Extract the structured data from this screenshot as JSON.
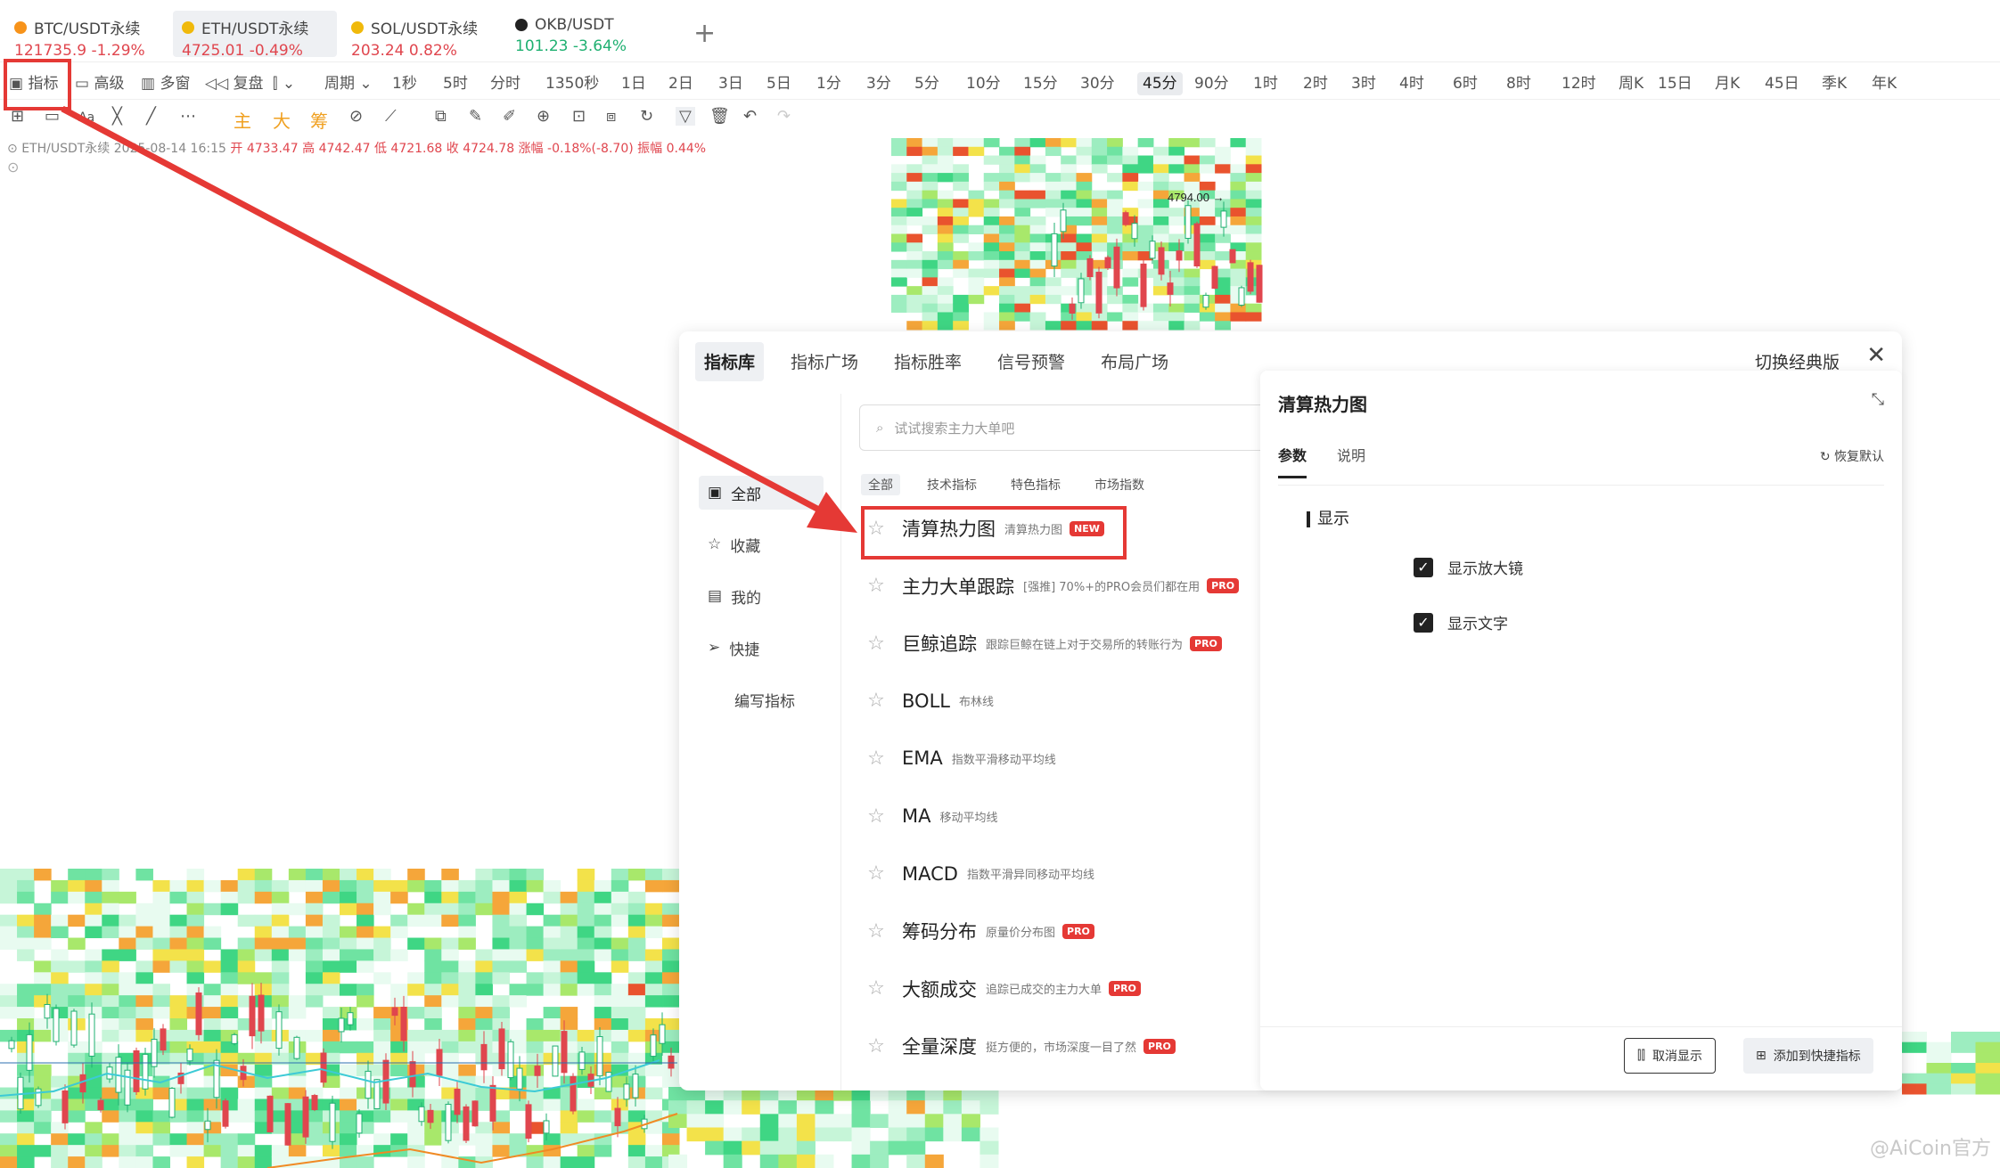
{
  "tabs": [
    {
      "symbol": "BTC/USDT永续",
      "price": "121735.9",
      "change": "-1.29%",
      "direction": "down",
      "icon_color": "#f7931a"
    },
    {
      "symbol": "ETH/USDT永续",
      "price": "4725.01",
      "change": "-0.49%",
      "direction": "down",
      "icon_color": "#f0b90b"
    },
    {
      "symbol": "SOL/USDT永续",
      "price": "203.24",
      "change": "0.82%",
      "direction": "down",
      "icon_color": "#f0b90b"
    },
    {
      "symbol": "OKB/USDT",
      "price": "101.23",
      "change": "-3.64%",
      "direction": "up",
      "icon_color": "#222222"
    }
  ],
  "add_tab": "+",
  "toolbar": {
    "indicator": "指标",
    "advanced": "高级",
    "multi_window": "多窗",
    "replay": "复盘",
    "period": "周期",
    "periods": [
      "1秒",
      "5时",
      "分时",
      "1350秒",
      "1日",
      "2日",
      "3日",
      "5日",
      "1分",
      "3分",
      "5分",
      "10分",
      "15分",
      "30分",
      "45分",
      "90分",
      "1时",
      "2时",
      "3时",
      "4时",
      "6时",
      "8时",
      "12时",
      "周K",
      "15日",
      "月K",
      "45日",
      "季K",
      "年K"
    ],
    "active_period": "45分"
  },
  "draw_tools": {
    "text_tool": "Aa",
    "main": "主",
    "big": "大",
    "chip": "筹"
  },
  "info_line": {
    "symbol": "ETH/USDT永续",
    "datetime": "2025-08-14 16:15",
    "open": "开 4733.47",
    "high": "高 4742.47",
    "low": "低 4721.68",
    "close": "收 4724.78",
    "change": "涨幅 -0.18%(-8.70)",
    "amplitude": "振幅 0.44%"
  },
  "chart_label": "4794.00 →",
  "dialog": {
    "tabs": [
      "指标库",
      "指标广场",
      "指标胜率",
      "信号预警",
      "布局广场"
    ],
    "switch_classic": "切换经典版",
    "close": "✕",
    "sidebar": [
      "全部",
      "收藏",
      "我的",
      "快捷",
      "编写指标"
    ],
    "search_placeholder": "试试搜索主力大单吧",
    "filters": [
      "全部",
      "技术指标",
      "特色指标",
      "市场指数"
    ],
    "indicators": [
      {
        "name": "清算热力图",
        "desc": "清算热力图",
        "badge": "NEW"
      },
      {
        "name": "主力大单跟踪",
        "desc": "[强推] 70%+的PRO会员们都在用",
        "badge": "PRO"
      },
      {
        "name": "巨鲸追踪",
        "desc": "跟踪巨鲸在链上对于交易所的转账行为",
        "badge": "PRO"
      },
      {
        "name": "BOLL",
        "desc": "布林线",
        "badge": ""
      },
      {
        "name": "EMA",
        "desc": "指数平滑移动平均线",
        "badge": ""
      },
      {
        "name": "MA",
        "desc": "移动平均线",
        "badge": ""
      },
      {
        "name": "MACD",
        "desc": "指数平滑异同移动平均线",
        "badge": ""
      },
      {
        "name": "筹码分布",
        "desc": "原量价分布图",
        "badge": "PRO"
      },
      {
        "name": "大额成交",
        "desc": "追踪已成交的主力大单",
        "badge": "PRO"
      },
      {
        "name": "全量深度",
        "desc": "挺方便的，市场深度一目了然",
        "badge": "PRO"
      }
    ]
  },
  "panel": {
    "title": "清算热力图",
    "tabs": [
      "参数",
      "说明"
    ],
    "reset": "恢复默认",
    "section": "显示",
    "options": [
      {
        "label": "显示放大镜",
        "checked": true
      },
      {
        "label": "显示文字",
        "checked": true
      }
    ],
    "cancel": "取消显示",
    "add": "添加到快捷指标"
  },
  "watermark": "@AiCoin官方"
}
